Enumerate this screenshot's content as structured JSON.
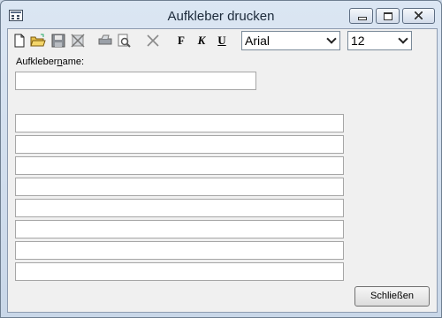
{
  "window": {
    "title": "Aufkleber drucken"
  },
  "toolbar": {
    "icons": [
      "new-document-icon",
      "open-folder-icon",
      "save-icon",
      "delete-icon",
      "print-icon",
      "print-preview-icon",
      "clear-icon",
      "bold-icon",
      "italic-icon",
      "underline-icon"
    ],
    "bold_label": "F",
    "italic_label": "K",
    "underline_label": "U",
    "font": {
      "selected": "Arial"
    },
    "size": {
      "selected": "12"
    }
  },
  "form": {
    "name_label_pre": "Aufkleber",
    "name_label_mnemonic": "n",
    "name_label_post": "ame:",
    "name_value": "",
    "lines": [
      "",
      "",
      "",
      "",
      "",
      "",
      "",
      ""
    ]
  },
  "buttons": {
    "close_label": "Schließen"
  }
}
